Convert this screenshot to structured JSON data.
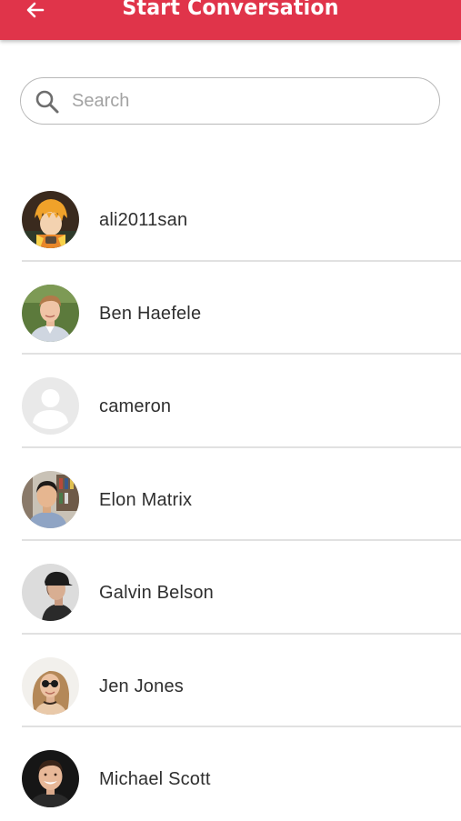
{
  "header": {
    "title": "Start Conversation",
    "back_icon": "arrow-left-icon",
    "background": "#e0344a"
  },
  "search": {
    "placeholder": "Search",
    "value": "",
    "icon": "search-icon"
  },
  "contacts": [
    {
      "name": "ali2011san",
      "avatar": "anime-character-avatar"
    },
    {
      "name": "Ben Haefele",
      "avatar": "photo-avatar"
    },
    {
      "name": "cameron",
      "avatar": "default-person-avatar"
    },
    {
      "name": "Elon Matrix",
      "avatar": "photo-avatar"
    },
    {
      "name": "Galvin Belson",
      "avatar": "photo-avatar"
    },
    {
      "name": "Jen Jones",
      "avatar": "photo-avatar"
    },
    {
      "name": "Michael Scott",
      "avatar": "photo-avatar"
    }
  ]
}
